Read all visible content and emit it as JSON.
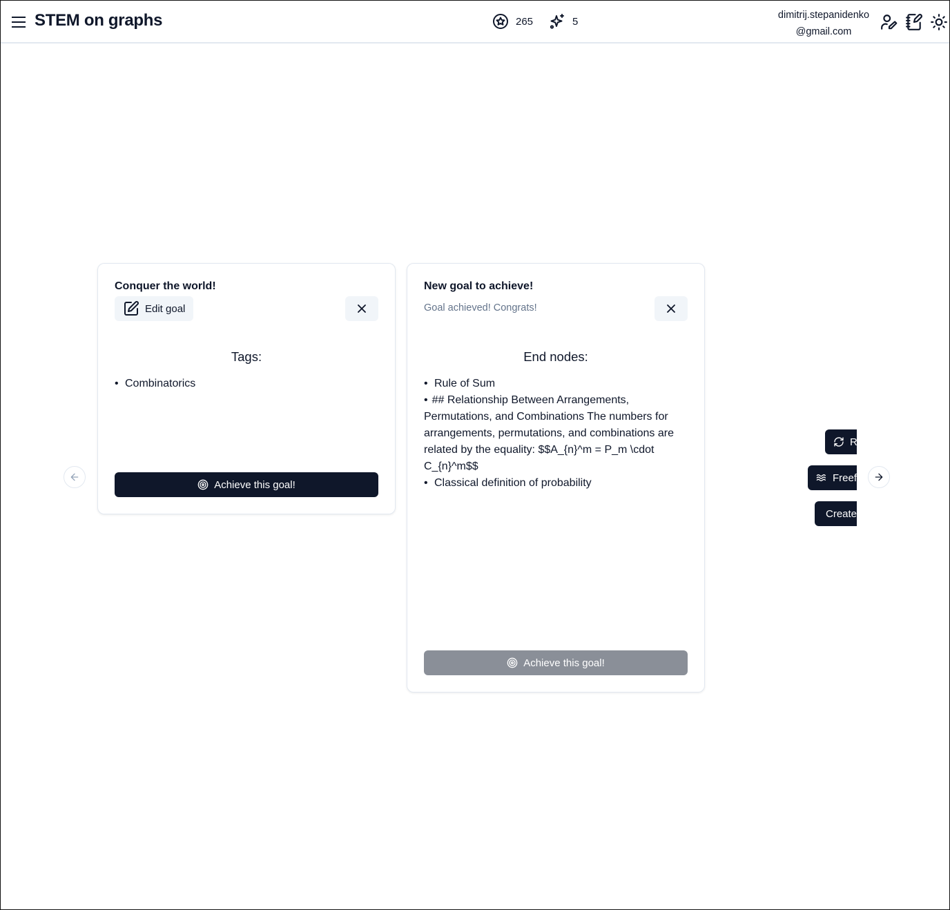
{
  "header": {
    "app_title": "STEM on graphs",
    "points_value": "265",
    "sparkles_value": "5",
    "user_email_line1": "dimitrij.stepanidenko",
    "user_email_line2": "@gmail.com",
    "icons": [
      "menu-icon",
      "badge-icon",
      "sparkles-icon",
      "user-edit-icon",
      "notebook-pen-icon",
      "sun-icon"
    ]
  },
  "cards": [
    {
      "title": "Conquer the world!",
      "edit_label": "Edit goal",
      "section_heading": "Tags:",
      "items": [
        "Combinatorics"
      ],
      "achieve_label": "Achieve this goal!"
    },
    {
      "title": "New goal to achieve!",
      "status_message": "Goal achieved! Congrats!",
      "section_heading": "End nodes:",
      "items": [
        "Rule of Sum",
        "## Relationship Between Arrangements, Permutations, and Combinations The numbers for arrangements, permutations, and combinations are related by the equality: $$A_{n}^m = P_m \\cdot C_{n}^m$$",
        "Classical definition of probability"
      ],
      "achieve_label": "Achieve this goal!"
    }
  ],
  "side_actions": {
    "refresh_label": "R",
    "freeform_label": "Freef",
    "create_label": "Create"
  },
  "colors": {
    "primary": "#0f172a",
    "disabled": "#8a8f98",
    "muted_text": "#64748b",
    "secondary_bg": "#f1f5f9",
    "border": "#e2e8f0"
  }
}
